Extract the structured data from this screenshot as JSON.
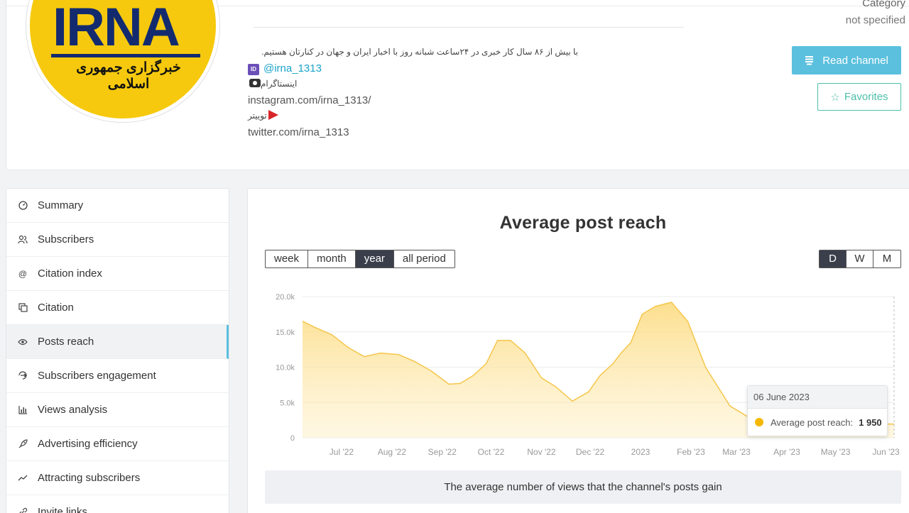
{
  "channel": {
    "logo": {
      "title": "IRNA",
      "subtitle": "خبرگزاری جمهوری اسلامی"
    },
    "description": [
      "با بیش از ۸۶ سال کار خبری در ۲۴ساعت شبانه روز با اخبار ایران و جهان در کنارتان هستیم.",
      "@irna_1313",
      "اینستاگرام",
      "instagram.com/irna_1313/",
      "توییتر",
      "twitter.com/irna_1313"
    ],
    "category_label": "Category",
    "category_value": "not specified",
    "read_button": "Read channel",
    "favorites_button": "Favorites"
  },
  "sidebar": {
    "items": [
      {
        "label": "Summary",
        "icon": "gauge-icon"
      },
      {
        "label": "Subscribers",
        "icon": "users-icon"
      },
      {
        "label": "Citation index",
        "icon": "at-icon"
      },
      {
        "label": "Citation",
        "icon": "quote-icon"
      },
      {
        "label": "Posts reach",
        "icon": "eye-icon",
        "active": true
      },
      {
        "label": "Subscribers engagement",
        "icon": "engagement-icon"
      },
      {
        "label": "Views analysis",
        "icon": "bar-chart-icon"
      },
      {
        "label": "Advertising efficiency",
        "icon": "rocket-icon"
      },
      {
        "label": "Attracting subscribers",
        "icon": "trend-icon"
      },
      {
        "label": "Invite links",
        "icon": "link-icon"
      }
    ]
  },
  "main": {
    "title": "Average post reach",
    "periods": [
      "week",
      "month",
      "year",
      "all period"
    ],
    "active_period": "year",
    "scales": [
      "D",
      "W",
      "M"
    ],
    "active_scale": "D",
    "caption": "The average number of views that the channel's posts gain",
    "tooltip": {
      "date": "06 June 2023",
      "label": "Average post reach:",
      "value": "1 950"
    }
  },
  "colors": {
    "accent": "#5bc0de",
    "fav": "#4dbfa9",
    "area_fill": "#fde9a8",
    "line": "#f5c64a",
    "dark": "#3a3f4b"
  },
  "chart_data": {
    "type": "area",
    "title": "Average post reach",
    "ylim": [
      0,
      20000
    ],
    "ytick_labels": [
      "0",
      "5.0k",
      "10.0k",
      "15.0k",
      "20.0k"
    ],
    "yticks": [
      0,
      5000,
      10000,
      15000,
      20000
    ],
    "xtick_labels": [
      "Jul '22",
      "Aug '22",
      "Sep '22",
      "Oct '22",
      "Nov '22",
      "Dec '22",
      "2023",
      "Feb '23",
      "Mar '23",
      "Apr '23",
      "May '23",
      "Jun '23"
    ],
    "xtick_dates": [
      "2022-07-01",
      "2022-08-01",
      "2022-09-01",
      "2022-10-01",
      "2022-11-01",
      "2022-12-01",
      "2023-01-01",
      "2023-02-01",
      "2023-03-01",
      "2023-04-01",
      "2023-05-01",
      "2023-06-01"
    ],
    "x_range": [
      "2022-06-07",
      "2023-06-06"
    ],
    "x": [
      "2022-06-07",
      "2022-06-15",
      "2022-06-25",
      "2022-07-05",
      "2022-07-15",
      "2022-07-25",
      "2022-08-05",
      "2022-08-15",
      "2022-08-25",
      "2022-09-05",
      "2022-09-12",
      "2022-09-20",
      "2022-09-28",
      "2022-10-05",
      "2022-10-13",
      "2022-10-22",
      "2022-11-01",
      "2022-11-10",
      "2022-11-20",
      "2022-11-30",
      "2022-12-07",
      "2022-12-15",
      "2022-12-20",
      "2022-12-26",
      "2023-01-02",
      "2023-01-10",
      "2023-01-20",
      "2023-01-30",
      "2023-02-10",
      "2023-02-25",
      "2023-03-15",
      "2023-04-01",
      "2023-04-20",
      "2023-05-10",
      "2023-05-30",
      "2023-06-06"
    ],
    "y": [
      16500,
      15600,
      14600,
      12800,
      11500,
      12000,
      11800,
      10800,
      9500,
      7600,
      7700,
      8800,
      10500,
      13800,
      13800,
      12000,
      8500,
      7200,
      5200,
      6500,
      8800,
      10500,
      12000,
      13500,
      17500,
      18600,
      19200,
      16500,
      10000,
      4500,
      2000,
      1900,
      1850,
      1900,
      1950,
      1950
    ],
    "grid": true
  }
}
